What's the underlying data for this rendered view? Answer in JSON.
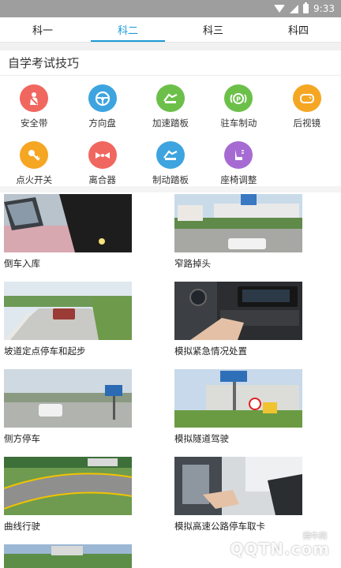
{
  "status": {
    "time": "9:33"
  },
  "tabs": [
    {
      "label": "科一",
      "active": false
    },
    {
      "label": "科二",
      "active": true
    },
    {
      "label": "科三",
      "active": false
    },
    {
      "label": "科四",
      "active": false
    }
  ],
  "section": {
    "title": "自学考试技巧"
  },
  "icons": [
    {
      "label": "安全带",
      "icon": "seatbelt-icon",
      "color": "#f0675f",
      "glyph": "👤"
    },
    {
      "label": "方向盘",
      "icon": "steering-wheel-icon",
      "color": "#3da4e0",
      "glyph": "⊛"
    },
    {
      "label": "加速踏板",
      "icon": "accelerator-pedal-icon",
      "color": "#6cc04a",
      "glyph": "⚙"
    },
    {
      "label": "驻车制动",
      "icon": "parking-brake-icon",
      "color": "#6cc04a",
      "glyph": "Ⓟ"
    },
    {
      "label": "后视镜",
      "icon": "rearview-mirror-icon",
      "color": "#f5a623",
      "glyph": "▭"
    },
    {
      "label": "点火开关",
      "icon": "ignition-key-icon",
      "color": "#f5a623",
      "glyph": "⚿"
    },
    {
      "label": "离合器",
      "icon": "clutch-icon",
      "color": "#f0675f",
      "glyph": "✦"
    },
    {
      "label": "制动踏板",
      "icon": "brake-pedal-icon",
      "color": "#3da4e0",
      "glyph": "⚙"
    },
    {
      "label": "座椅调整",
      "icon": "seat-adjust-icon",
      "color": "#a66bd3",
      "glyph": "⊿"
    }
  ],
  "lessons": [
    {
      "label": "倒车入库"
    },
    {
      "label": "窄路掉头"
    },
    {
      "label": "坡道定点停车和起步"
    },
    {
      "label": "模拟紧急情况处置"
    },
    {
      "label": "侧方停车"
    },
    {
      "label": "模拟隧道驾驶"
    },
    {
      "label": "曲线行驶"
    },
    {
      "label": "模拟高速公路停车取卡"
    },
    {
      "label": ""
    }
  ],
  "watermark": {
    "brand": "QQTN.com",
    "small": "腾牛网"
  }
}
